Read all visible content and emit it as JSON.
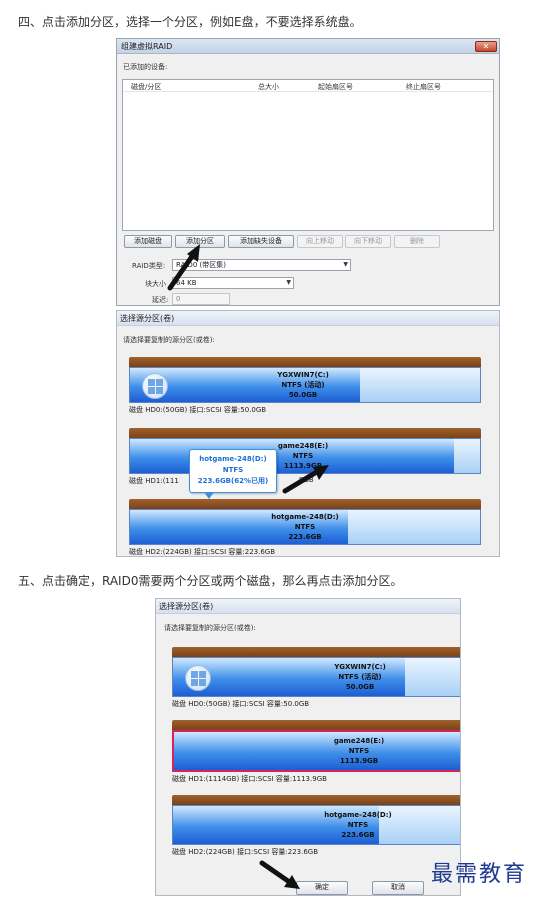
{
  "steps": {
    "step4": "四、点击添加分区，选择一个分区，例如E盘，不要选择系统盘。",
    "step5": "五、点击确定，RAID0需要两个分区或两个磁盘，那么再点击添加分区。"
  },
  "raid_dialog": {
    "title": "组建虚拟RAID",
    "added_devices_label": "已添加的设备:",
    "columns": [
      "磁盘/分区",
      "总大小",
      "起始扇区号",
      "终止扇区号"
    ],
    "buttons": {
      "add_disk": "添加磁盘",
      "add_partition": "添加分区",
      "add_missing_device": "添加缺失设备",
      "move_up": "向上移动",
      "move_down": "向下移动",
      "remove": "删除"
    },
    "raid_type_label": "RAID类型:",
    "raid_type_value": "RAID0 (带区集)",
    "block_size_label": "块大小",
    "block_size_value": "64 KB",
    "delay_label": "延迟:",
    "delay_value": "0"
  },
  "source_dialog": {
    "title": "选择源分区(卷)",
    "instruction": "请选择要复制的源分区(或卷):",
    "disks": [
      {
        "volume_name": "YGXWIN7(C:)",
        "fs": "NTFS (活动)",
        "size": "50.0GB",
        "info": "磁盘 HD0:(50GB)  接口:SCSI  容量:50.0GB"
      },
      {
        "volume_name": "game248(E:)",
        "fs": "NTFS",
        "size": "1113.9GB",
        "info": "磁盘 HD1:(1114GB)  接口:SCSI  容量:1113.9GB",
        "info_occluded": "磁盘 HD1:(111",
        "info_tail": "9GB"
      },
      {
        "volume_name": "hotgame-248(D:)",
        "fs": "NTFS",
        "size": "223.6GB",
        "info": "磁盘 HD2:(224GB)  接口:SCSI  容量:223.6GB"
      }
    ],
    "tooltip": {
      "name": "hotgame-248(D:)",
      "fs": "NTFS",
      "usage": "223.6GB(62%已用)"
    },
    "ok_button": "确定",
    "cancel_button": "取消"
  },
  "watermark": "最需教育",
  "colors": {
    "disk_header": "#8b4f20",
    "volume_blue": "#3f8fea",
    "selected_border": "#d6245a",
    "watermark": "#1f3a93"
  }
}
